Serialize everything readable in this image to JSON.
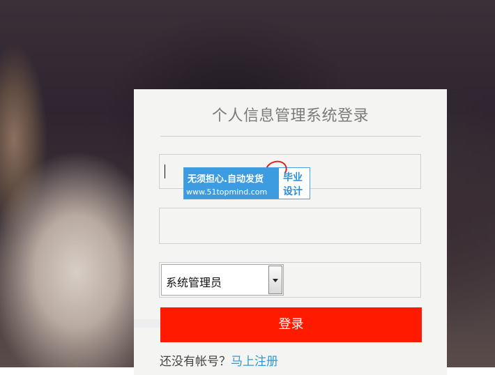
{
  "login": {
    "title": "个人信息管理系统登录",
    "username_value": "",
    "password_value": "",
    "role_selected": "系统管理员",
    "login_button_label": "登录",
    "no_account_text": "还没有帐号？",
    "register_link_label": "马上注册"
  },
  "watermark": {
    "line1": "无须担心.自动发货",
    "line2": "www.51topmind.com",
    "right_line1": "毕业",
    "right_line2": "设计"
  },
  "colors": {
    "login_button": "#ff1a00",
    "register_link": "#2a9bd8",
    "watermark_blue": "#3d9be0"
  },
  "icons": {
    "role_dropdown": "chevron-down-icon"
  }
}
